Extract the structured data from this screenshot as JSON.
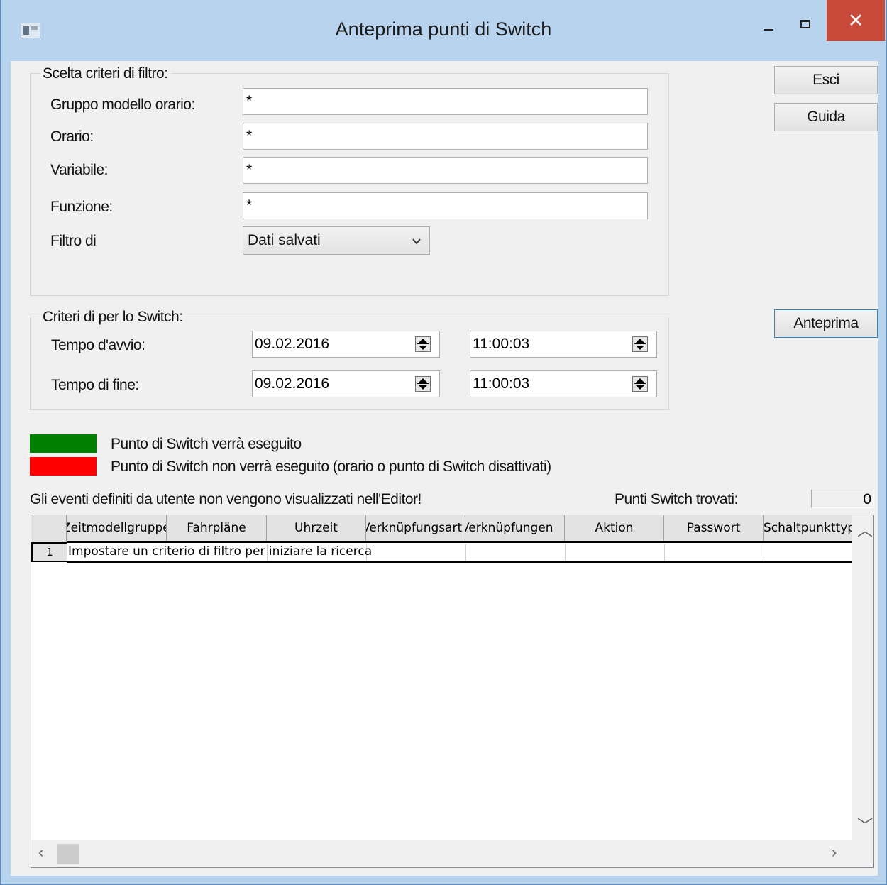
{
  "window": {
    "title": "Anteprima punti di Switch",
    "close_glyph": "✕"
  },
  "buttons": {
    "exit": "Esci",
    "help": "Guida",
    "preview": "Anteprima"
  },
  "filter_group": {
    "legend": "Scelta criteri di filtro:",
    "fields": [
      {
        "label": "Gruppo modello orario:",
        "value": "*"
      },
      {
        "label": "Orario:",
        "value": "*"
      },
      {
        "label": "Variabile:",
        "value": "*"
      },
      {
        "label": "Funzione:",
        "value": "*"
      }
    ],
    "filter_by_label": "Filtro di",
    "filter_by_value": "Dati salvati"
  },
  "switch_group": {
    "legend": "Criteri di per lo Switch:",
    "start_label": "Tempo d'avvio:",
    "start_date": "09.02.2016",
    "start_time": "11:00:03",
    "end_label": "Tempo di fine:",
    "end_date": "09.02.2016",
    "end_time": "11:00:03"
  },
  "legend_items": {
    "will_execute": {
      "color": "#008000",
      "text": "Punto di Switch verrà eseguito"
    },
    "will_not_execute": {
      "color": "#ff0000",
      "text": "Punto di Switch non verrà eseguito (orario o punto di Switch disattivati)"
    }
  },
  "info_text": "Gli eventi definiti da utente non vengono visualizzati nell'Editor!",
  "found": {
    "label": "Punti Switch trovati:",
    "count": "0"
  },
  "grid": {
    "columns": [
      "Zeitmodellgruppe",
      "Fahrpläne",
      "Uhrzeit",
      "Verknüpfungsart",
      "Verknüpfungen",
      "Aktion",
      "Passwort",
      "Schaltpunkttyp"
    ],
    "rows": [
      {
        "num": "1",
        "text": "Impostare un criterio di filtro per iniziare la ricerca"
      }
    ]
  }
}
